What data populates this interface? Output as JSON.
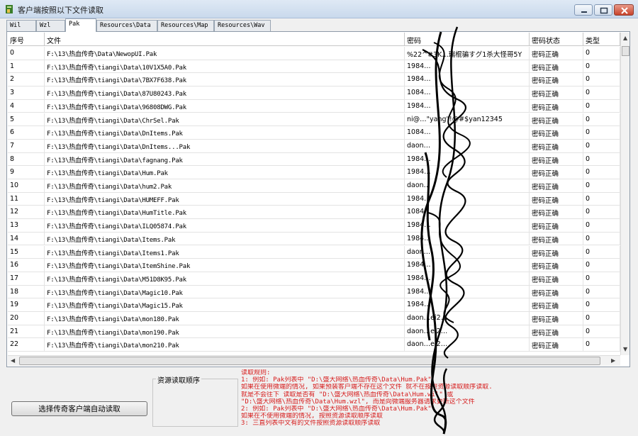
{
  "window": {
    "title": "客户端按照以下文件读取",
    "colors": {
      "title_bg": "#c9d9ec",
      "close": "#c8432b",
      "rules_text": "#d61b1b"
    }
  },
  "tabs": [
    {
      "label": "Wil",
      "active": false
    },
    {
      "label": "Wzl",
      "active": false
    },
    {
      "label": "Pak",
      "active": true
    },
    {
      "label": "Resources\\Data",
      "active": false
    },
    {
      "label": "Resources\\Map",
      "active": false
    },
    {
      "label": "Resources\\Wav",
      "active": false
    }
  ],
  "table": {
    "columns": [
      "序号",
      "文件",
      "密码",
      "密码状态",
      "类型"
    ],
    "rows": [
      {
        "index": "0",
        "file": "F:\\13\\热血传奇\\Data\\NewopUI.Pak",
        "password": "%22^#3K…瑞棍骗すグ1杀大怪哥5Y",
        "status": "密码正确",
        "type": "0"
      },
      {
        "index": "1",
        "file": "F:\\13\\热血传奇\\tiangi\\Data\\10V1X5A0.Pak",
        "password": "1984…",
        "status": "密码正确",
        "type": "0"
      },
      {
        "index": "2",
        "file": "F:\\13\\热血传奇\\tiangi\\Data\\7BX7F638.Pak",
        "password": "1984…",
        "status": "密码正确",
        "type": "0"
      },
      {
        "index": "3",
        "file": "F:\\13\\热血传奇\\tiangi\\Data\\87U80243.Pak",
        "password": "1084…",
        "status": "密码正确",
        "type": "0"
      },
      {
        "index": "4",
        "file": "F:\\13\\热血传奇\\tiangi\\Data\\96808DWG.Pak",
        "password": "1984…",
        "status": "密码正确",
        "type": "0"
      },
      {
        "index": "5",
        "file": "F:\\13\\热血传奇\\tiangi\\Data\\ChrSel.Pak",
        "password": "ni@…\"yang\"!@#$yan12345",
        "status": "密码正确",
        "type": "0"
      },
      {
        "index": "6",
        "file": "F:\\13\\热血传奇\\tiangi\\Data\\DnItems.Pak",
        "password": "1084…",
        "status": "密码正确",
        "type": "0"
      },
      {
        "index": "7",
        "file": "F:\\13\\热血传奇\\tiangi\\Data\\DnItems...Pak",
        "password": "daon…",
        "status": "密码正确",
        "type": "0"
      },
      {
        "index": "8",
        "file": "F:\\13\\热血传奇\\tiangi\\Data\\fagnang.Pak",
        "password": "1984…",
        "status": "密码正确",
        "type": "0"
      },
      {
        "index": "9",
        "file": "F:\\13\\热血传奇\\tiangi\\Data\\Hum.Pak",
        "password": "1984…",
        "status": "密码正确",
        "type": "0"
      },
      {
        "index": "10",
        "file": "F:\\13\\热血传奇\\tiangi\\Data\\hum2.Pak",
        "password": "daon…",
        "status": "密码正确",
        "type": "0"
      },
      {
        "index": "11",
        "file": "F:\\13\\热血传奇\\tiangi\\Data\\HUMEFF.Pak",
        "password": "1984…",
        "status": "密码正确",
        "type": "0"
      },
      {
        "index": "12",
        "file": "F:\\13\\热血传奇\\tiangi\\Data\\HumTitle.Pak",
        "password": "1084…",
        "status": "密码正确",
        "type": "0"
      },
      {
        "index": "13",
        "file": "F:\\13\\热血传奇\\tiangi\\Data\\ILQ05874.Pak",
        "password": "1984…",
        "status": "密码正确",
        "type": "0"
      },
      {
        "index": "14",
        "file": "F:\\13\\热血传奇\\tiangi\\Data\\Items.Pak",
        "password": "1984…",
        "status": "密码正确",
        "type": "0"
      },
      {
        "index": "15",
        "file": "F:\\13\\热血传奇\\tiangi\\Data\\Items1.Pak",
        "password": "daon…",
        "status": "密码正确",
        "type": "0"
      },
      {
        "index": "16",
        "file": "F:\\13\\热血传奇\\tiangi\\Data\\ItemShine.Pak",
        "password": "1984…",
        "status": "密码正确",
        "type": "0"
      },
      {
        "index": "17",
        "file": "F:\\13\\热血传奇\\tiangi\\Data\\M51D8K95.Pak",
        "password": "1984…",
        "status": "密码正确",
        "type": "0"
      },
      {
        "index": "18",
        "file": "F:\\13\\热血传奇\\tiangi\\Data\\Magic10.Pak",
        "password": "1984…",
        "status": "密码正确",
        "type": "0"
      },
      {
        "index": "19",
        "file": "F:\\13\\热血传奇\\tiangi\\Data\\Magic15.Pak",
        "password": "1984…",
        "status": "密码正确",
        "type": "0"
      },
      {
        "index": "20",
        "file": "F:\\13\\热血传奇\\tiangi\\Data\\mon180.Pak",
        "password": "daon…ei2…",
        "status": "密码正确",
        "type": "0"
      },
      {
        "index": "21",
        "file": "F:\\13\\热血传奇\\tiangi\\Data\\mon190.Pak",
        "password": "daon…ei2…",
        "status": "密码正确",
        "type": "0"
      },
      {
        "index": "22",
        "file": "F:\\13\\热血传奇\\tiangi\\Data\\mon210.Pak",
        "password": "daon…ei2…",
        "status": "密码正确",
        "type": "0"
      }
    ]
  },
  "order_group_label": "资源读取顺序",
  "auto_button_label": "选择传奇客户端自动读取",
  "rules_lines": [
    "读取规则:",
    "1: 例如: Pak列表中 \"D:\\盛大网络\\热血传奇\\Data\\Hum.Pak\"",
    "   如果在使用微端的情况, 如果预装客户端不存在这个文件 就不在按照资源读取顺序读取.",
    "   就是不会往下 读取是否有 \"D:\\盛大网络\\热血传奇\\Data\\Hum.wil\" 或",
    "   \"D:\\盛大网络\\热血传奇\\Data\\Hum.wzl\", 而是向微端服务器请求更新这个文件",
    "2: 例如: Pak列表中 \"D:\\盛大网络\\热血传奇\\Data\\Hum.Pak\"",
    "   如果在不使用微端的情况, 按照资源读取顺序读取",
    "3: 三直列表中文有的文件按照资源读取顺序读取"
  ]
}
